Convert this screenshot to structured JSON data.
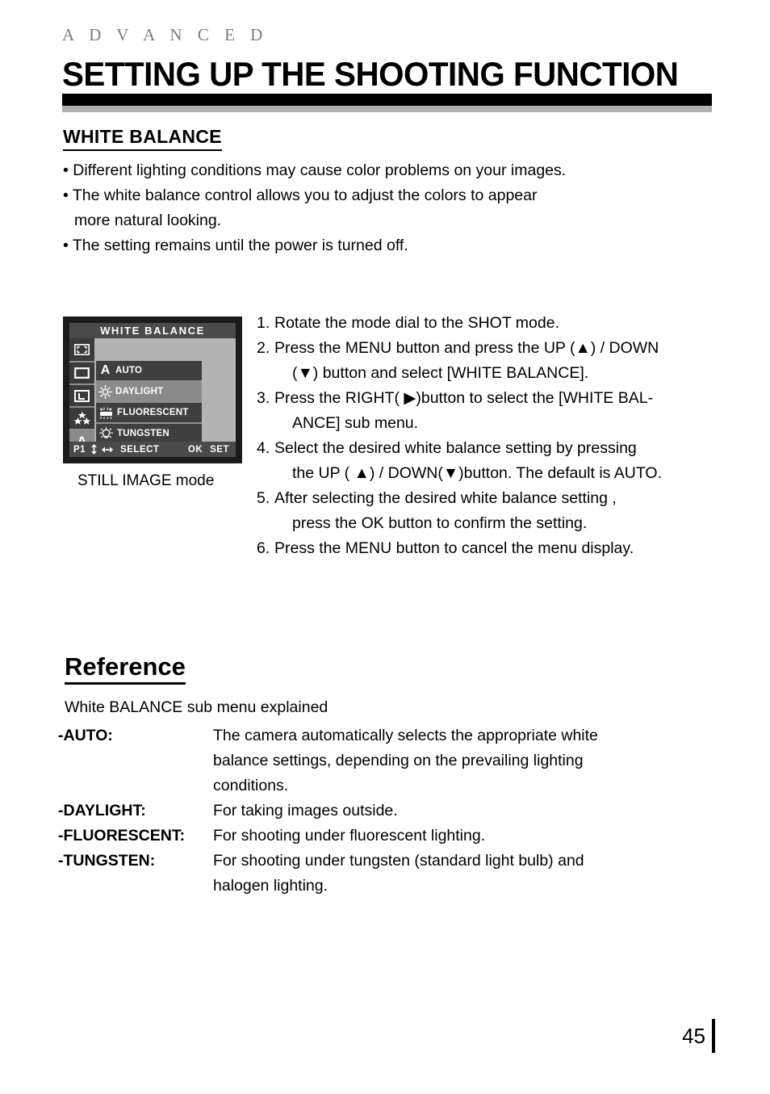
{
  "header": {
    "kicker": "A D V A N C E D",
    "title": "SETTING UP THE SHOOTING FUNCTION"
  },
  "section": {
    "heading": "WHITE BALANCE",
    "bullets": [
      "• Different lighting conditions may cause color problems on your images.",
      "• The white balance control allows you to adjust the colors to appear",
      "more natural looking.",
      "• The setting remains until the power is turned off."
    ]
  },
  "lcd": {
    "title": "WHITE BALANCE",
    "caption": "STILL IMAGE mode",
    "side_icons": [
      {
        "name": "framing-marks-icon",
        "active": false
      },
      {
        "name": "image-size-icon",
        "active": false
      },
      {
        "name": "image-quality-icon",
        "active": false
      },
      {
        "name": "three-stars-icon",
        "active": false
      },
      {
        "name": "letter-a-icon",
        "active": true
      }
    ],
    "items": [
      {
        "label": "AUTO",
        "icon": "letter-a-icon",
        "selected": false
      },
      {
        "label": "DAYLIGHT",
        "icon": "sun-icon",
        "selected": true
      },
      {
        "label": "FLUORESCENT",
        "icon": "fluorescent-tube-icon",
        "selected": false
      },
      {
        "label": "TUNGSTEN",
        "icon": "light-bulb-icon",
        "selected": false
      }
    ],
    "footer": {
      "page": "P1",
      "updown_icon": "up-down-arrows-icon",
      "leftright_icon": "left-right-arrows-icon",
      "select": "SELECT",
      "ok": "OK",
      "set": "SET"
    }
  },
  "steps": [
    {
      "num": "1.",
      "text": "Rotate the mode dial to the SHOT mode.",
      "cont": ""
    },
    {
      "num": "2.",
      "text": "Press the MENU button and press the UP (▲) / DOWN",
      "cont": "(▼) button and select [WHITE BALANCE]."
    },
    {
      "num": "3.",
      "text": "Press the RIGHT( ▶)button to select the [WHITE BAL-",
      "cont": "ANCE] sub menu."
    },
    {
      "num": "4.",
      "text": "Select the desired white balance setting by pressing",
      "cont": "the UP ( ▲) / DOWN(▼)button. The default is AUTO."
    },
    {
      "num": "5.",
      "text": "After selecting the desired white balance setting ,",
      "cont": "press the OK button to confirm the setting."
    },
    {
      "num": "6.",
      "text": "Press the MENU button to cancel the menu display.",
      "cont": ""
    }
  ],
  "reference": {
    "heading": "Reference",
    "intro": "White BALANCE sub menu explained",
    "rows": [
      {
        "term": "-AUTO:",
        "def": "The camera automatically selects the appropriate white",
        "cont1": "balance settings, depending on the prevailing lighting",
        "cont2": "conditions."
      },
      {
        "term": "-DAYLIGHT:",
        "def": "For taking images outside.",
        "cont1": "",
        "cont2": ""
      },
      {
        "term": "-FLUORESCENT:",
        "def": "For shooting under fluorescent lighting.",
        "cont1": "",
        "cont2": ""
      },
      {
        "term": "-TUNGSTEN:",
        "def": "For shooting under tungsten (standard light bulb) and",
        "cont1": "halogen lighting.",
        "cont2": ""
      }
    ]
  },
  "footer": {
    "page_number": "45"
  },
  "colors": {
    "rule_black": "#000000",
    "rule_gray": "#b0b0b0",
    "kicker_gray": "#7c7c7c",
    "lcd_bezel": "#1b1b1b",
    "lcd_background": "#b3b3b3",
    "lcd_bar": "#4a4a4a",
    "lcd_row": "#3f3f3f",
    "lcd_row_selected": "#8a8a8a"
  }
}
